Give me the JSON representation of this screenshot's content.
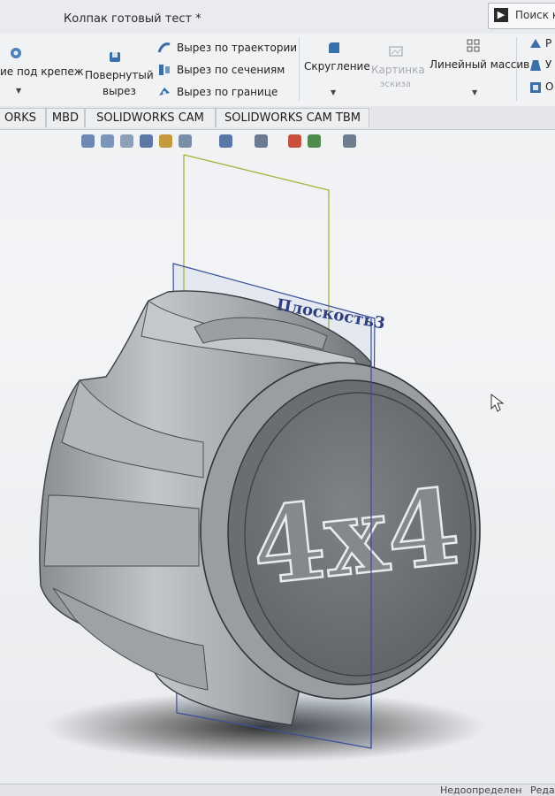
{
  "titlebar": {
    "title": "Колпак готовый тест *",
    "search_label": "Поиск к"
  },
  "ribbon": {
    "hole": {
      "label": "ие под крепеж"
    },
    "revolved_cut": {
      "line1": "Повернутый",
      "line2": "вырез"
    },
    "cuts": [
      {
        "label": "Вырез по траектории"
      },
      {
        "label": "Вырез по сечениям"
      },
      {
        "label": "Вырез по границе"
      }
    ],
    "fillet": {
      "label": "Скругление"
    },
    "sketch_picture": {
      "line1": "Картинка",
      "line2": "эскиза"
    },
    "linear_pattern": {
      "label": "Линейный массив"
    },
    "right_stub": [
      {
        "label": "Р"
      },
      {
        "label": "У"
      },
      {
        "label": "О"
      }
    ]
  },
  "tabs": [
    {
      "label": "ORKS"
    },
    {
      "label": "MBD"
    },
    {
      "label": "SOLIDWORKS CAM"
    },
    {
      "label": "SOLIDWORKS CAM TBM"
    }
  ],
  "viewport": {
    "plane_label": "Плоскость3",
    "emboss_text": "4x4"
  },
  "status": {
    "left": "Недоопределен",
    "right": "Реда"
  }
}
